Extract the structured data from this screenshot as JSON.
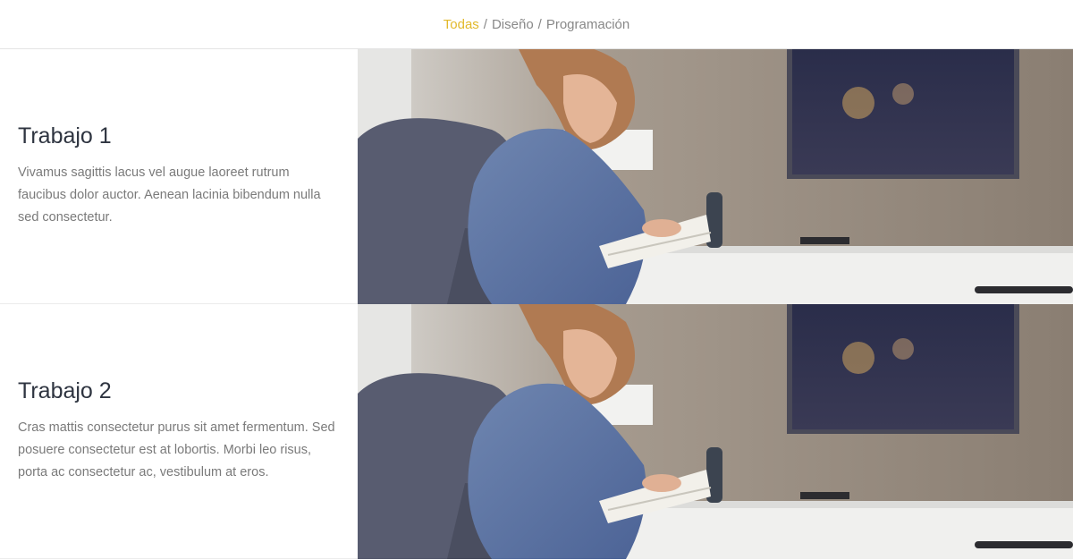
{
  "filters": {
    "items": [
      {
        "label": "Todas",
        "active": true
      },
      {
        "label": "Diseño",
        "active": false
      },
      {
        "label": "Programación",
        "active": false
      }
    ],
    "separator": "/"
  },
  "works": [
    {
      "title": "Trabajo 1",
      "description": "Vivamus sagittis lacus vel augue laoreet rutrum faucibus dolor auctor. Aenean lacinia bibendum nulla sed consectetur."
    },
    {
      "title": "Trabajo 2",
      "description": "Cras mattis consectetur purus sit amet fermentum. Sed posuere consectetur est at lobortis. Morbi leo risus, porta ac consectetur ac, vestibulum at eros."
    }
  ],
  "colors": {
    "accent": "#e2b92b",
    "muted_text": "#888888",
    "title_text": "#2e3440"
  }
}
